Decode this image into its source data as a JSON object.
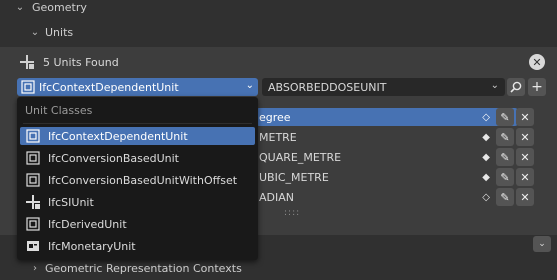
{
  "geometry_panel": {
    "label": "Geometry"
  },
  "units_panel": {
    "label": "Units"
  },
  "units_found": {
    "text": "5 Units Found"
  },
  "toolbar": {
    "unit_class_selected": "IfcContextDependentUnit",
    "unit_type_selected": "ABSORBEDDOSEUNIT"
  },
  "dropdown": {
    "title": "Unit Classes",
    "items": [
      {
        "label": "IfcContextDependentUnit",
        "icon": "context-unit-icon",
        "selected": true
      },
      {
        "label": "IfcConversionBasedUnit",
        "icon": "conversion-unit-icon",
        "selected": false
      },
      {
        "label": "IfcConversionBasedUnitWithOffset",
        "icon": "conversion-offset-icon",
        "selected": false
      },
      {
        "label": "IfcSIUnit",
        "icon": "si-unit-icon",
        "selected": false
      },
      {
        "label": "IfcDerivedUnit",
        "icon": "derived-unit-icon",
        "selected": false
      },
      {
        "label": "IfcMonetaryUnit",
        "icon": "monetary-unit-icon",
        "selected": false
      }
    ]
  },
  "unit_list": [
    {
      "name": "egree",
      "diamond": "◇",
      "selected": true
    },
    {
      "name": "METRE",
      "diamond": "◆",
      "selected": false
    },
    {
      "name": "QUARE_METRE",
      "diamond": "◆",
      "selected": false
    },
    {
      "name": "UBIC_METRE",
      "diamond": "◆",
      "selected": false
    },
    {
      "name": "ADIAN",
      "diamond": "◇",
      "selected": false
    }
  ],
  "grip": "::::",
  "next_panel": {
    "label": "Geometric Representation Contexts"
  },
  "colors": {
    "accent": "#4772b3",
    "background": "#303030",
    "popup": "#191919"
  }
}
